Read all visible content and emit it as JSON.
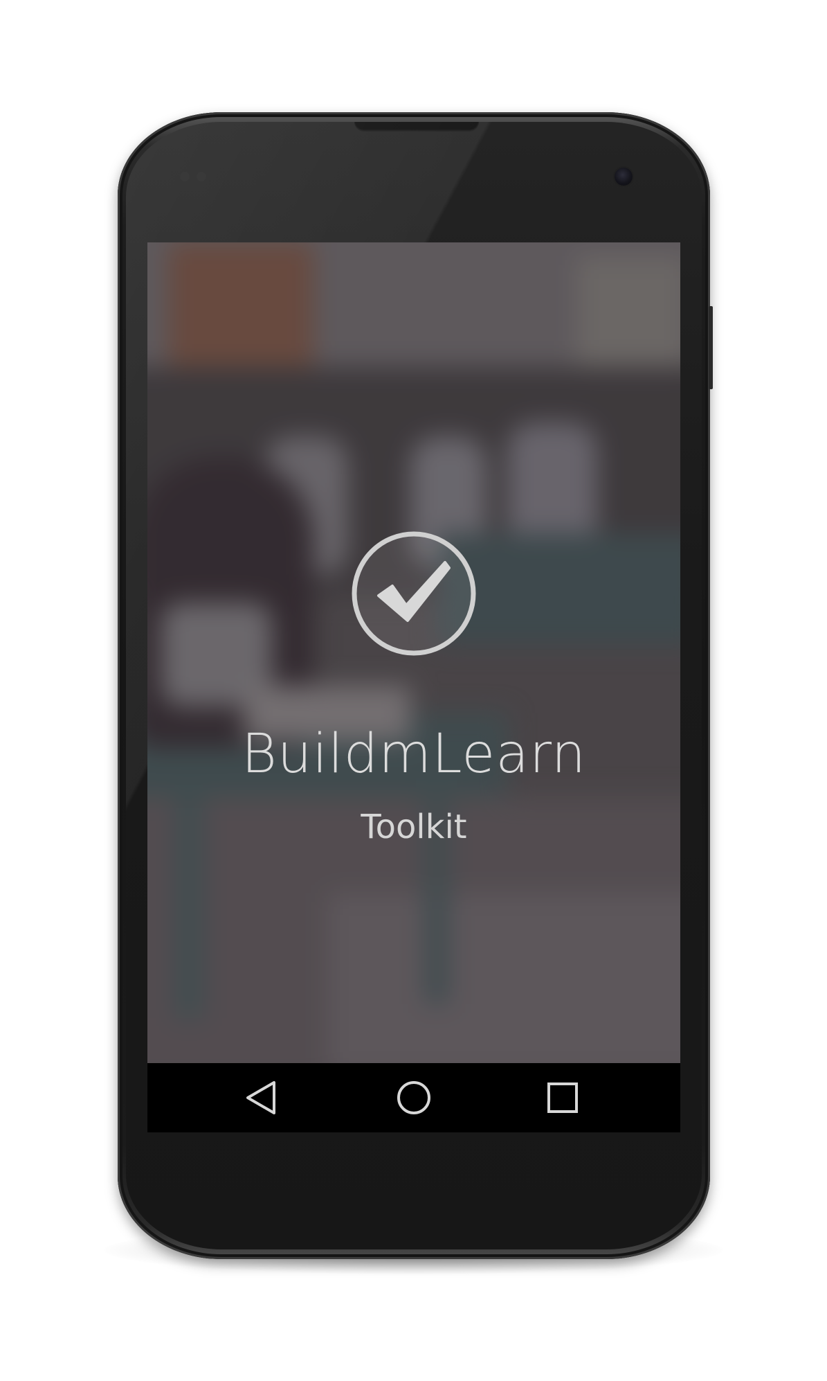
{
  "app": {
    "title": "BuildmLearn",
    "subtitle": "Toolkit",
    "logo_icon": "checkmark-circle-icon"
  },
  "navigation_bar": {
    "back_icon": "back-triangle-icon",
    "home_icon": "home-circle-icon",
    "recents_icon": "recents-square-icon"
  },
  "colors": {
    "title_text": "#dcdcdc",
    "navbar_background": "#000000",
    "device_body": "#1a1a1a",
    "nav_icon_stroke": "#d8d8d8"
  }
}
